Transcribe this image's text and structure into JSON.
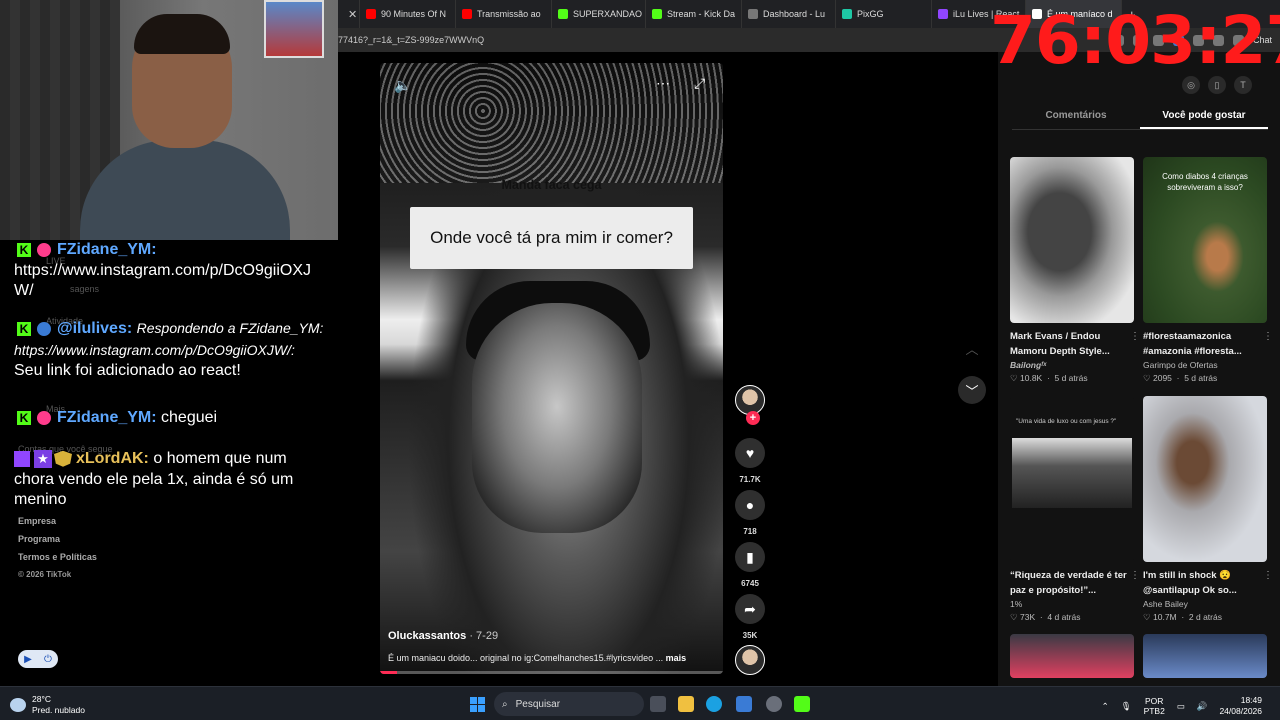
{
  "browser": {
    "tabs": [
      {
        "title": "",
        "color": "#555555"
      },
      {
        "title": "90 Minutes Of N",
        "color": "#ff0000"
      },
      {
        "title": "Transmissão ao",
        "color": "#ff0000"
      },
      {
        "title": "SUPERXANDAO",
        "color": "#53fc18"
      },
      {
        "title": "Stream - Kick Da",
        "color": "#53fc18"
      },
      {
        "title": "Dashboard - Lu",
        "color": "#777777"
      },
      {
        "title": "PixGG",
        "color": "#1ec8a5"
      },
      {
        "title": "iLu Lives | React",
        "color": "#9146ff"
      },
      {
        "title": "É um maníaco d",
        "color": "#ffffff"
      }
    ],
    "url": "77416?_r=1&_t=ZS-999ze7WWVnQ",
    "chat_button": "Chat"
  },
  "timer": "76:03:27",
  "chat": {
    "ghost": [
      "LIVE",
      "sagens",
      "Atividade",
      "Mais",
      "Contas que você segue"
    ],
    "messages": [
      {
        "user": "FZidane_YM:",
        "text": "https://www.instagram.com/p/DcO9giiOXJW/"
      },
      {
        "user": "@ilulives:",
        "reply": "Respondendo a FZidane_YM: https://www.instagram.com/p/DcO9giiOXJW/:",
        "text": "Seu link foi adicionado ao react!"
      },
      {
        "user": "FZidane_YM:",
        "text": "cheguei"
      },
      {
        "user": "xLordAK:",
        "text": "o homem que num chora vendo ele pela 1x, ainda é só um menino"
      }
    ],
    "footer": [
      "Empresa",
      "Programa",
      "Termos e Políticas"
    ],
    "copyright": "© 2026 TikTok"
  },
  "video": {
    "title": "Manda faca cega",
    "caption": "Onde você tá pra mim ir comer?",
    "author": "Oluckassantos",
    "date": "· 7-29",
    "description": "É um maniacu doido... original no ig:Comelhanches15.#lyricsvideo ...",
    "more": "mais",
    "progress": 0.05
  },
  "actions": {
    "likes": "71.7K",
    "comments": "718",
    "saves": "6745",
    "shares": "35K"
  },
  "right_panel": {
    "tabs": [
      "Comentários",
      "Você pode gostar"
    ],
    "cards": [
      {
        "thumb_text": "",
        "title": "Mark Evans / Endou Mamoru Depth Style...",
        "author": "Bailongᶠˣ",
        "likes": "10.8K",
        "age": "5 d atrás"
      },
      {
        "thumb_text": "Como diabos 4 crianças sobreviveram a isso?",
        "title": "#florestaamazonica #amazonia #floresta...",
        "author": "Garimpo de Ofertas",
        "likes": "2095",
        "age": "5 d atrás"
      },
      {
        "thumb_text": "\"Uma vida de luxo ou com jesus ?\"",
        "title": "“Riqueza de verdade é ter paz e propósito!”...",
        "author": "1%",
        "likes": "73K",
        "age": "4 d atrás"
      },
      {
        "thumb_text": "",
        "title": "I'm still in shock 😧 @santilapup Ok so...",
        "author": "Ashe Bailey",
        "likes": "10.7M",
        "age": "2 d atrás"
      }
    ]
  },
  "taskbar": {
    "temp": "28°C",
    "weather": "Pred. nublado",
    "search": "Pesquisar",
    "lang": "POR",
    "layout": "PTB2",
    "time": "18:49",
    "date": "24/08/2026"
  }
}
